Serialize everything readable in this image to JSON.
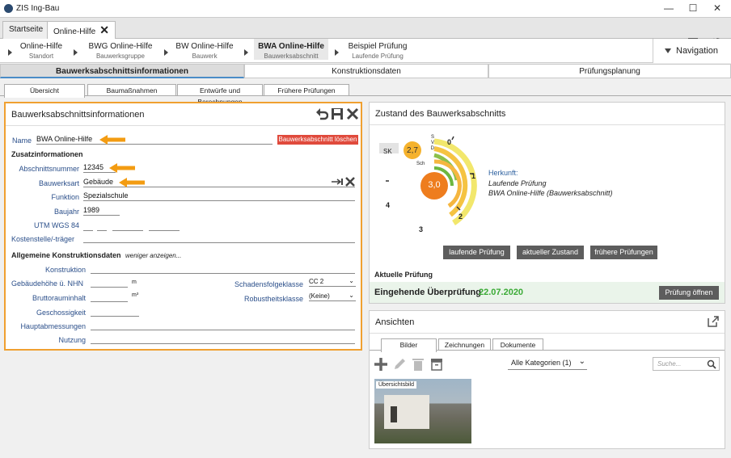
{
  "app": {
    "title": "ZIS Ing-Bau"
  },
  "tabs": [
    {
      "label": "Startseite"
    },
    {
      "label": "Online-Hilfe"
    }
  ],
  "breadcrumbs": [
    {
      "title": "Online-Hilfe",
      "sub": "Standort"
    },
    {
      "title": "BWG Online-Hilfe",
      "sub": "Bauwerksgruppe"
    },
    {
      "title": "BW Online-Hilfe",
      "sub": "Bauwerk"
    },
    {
      "title": "BWA Online-Hilfe",
      "sub": "Bauwerksabschnitt"
    },
    {
      "title": "Beispiel Prüfung",
      "sub": "Laufende Prüfung"
    }
  ],
  "navigation_label": "Navigation",
  "sections": [
    "Bauwerksabschnittsinformationen",
    "Konstruktionsdaten",
    "Prüfungsplanung"
  ],
  "subtabs": [
    "Übersicht",
    "Baumaßnahmen",
    "Entwürfe und Berechnungen",
    "Frühere Prüfungen"
  ],
  "info": {
    "header": "Bauwerksabschnittsinformationen",
    "name_label": "Name",
    "name_value": "BWA Online-Hilfe",
    "delete_button": "Bauwerksabschnitt löschen",
    "zusatz_heading": "Zusatzinformationen",
    "abschnitt_label": "Abschnittsnummer",
    "abschnitt_value": "12345",
    "bauwerksart_label": "Bauwerksart",
    "bauwerksart_value": "Gebäude",
    "funktion_label": "Funktion",
    "funktion_value": "Spezialschule",
    "baujahr_label": "Baujahr",
    "baujahr_value": "1989",
    "utm_label": "UTM WGS 84",
    "kosten_label": "Kostenstelle/-träger",
    "allg_heading": "Allgemeine Konstruktionsdaten",
    "weniger": "weniger anzeigen...",
    "konstruktion_label": "Konstruktion",
    "hoehe_label": "Gebäudehöhe ü. NHN",
    "hoehe_unit": "m",
    "brutto_label": "Bruttorauminhalt",
    "brutto_unit": "m³",
    "geschoss_label": "Geschossigkeit",
    "haupt_label": "Hauptabmessungen",
    "nutzung_label": "Nutzung",
    "schaden_label": "Schadensfolgeklasse",
    "schaden_value": "CC 2",
    "robust_label": "Robustheitsklasse",
    "robust_value": "(Keine)"
  },
  "zustand": {
    "header": "Zustand des Bauwerksabschnitts",
    "sk_label": "SK",
    "sk_value": "2,7",
    "center_value": "3,0",
    "ring_labels": [
      "S",
      "V",
      "D",
      "Sch"
    ],
    "scale": [
      "0",
      "1",
      "2",
      "3",
      "4"
    ],
    "herkunft_label": "Herkunft:",
    "herkunft_line1": "Laufende Prüfung",
    "herkunft_line2": "BWA Online-Hilfe (Bauwerksabschnitt)",
    "buttons": [
      "laufende Prüfung",
      "aktueller Zustand",
      "frühere Prüfungen"
    ],
    "aktuelle_label": "Aktuelle Prüfung",
    "pruefung_type": "Eingehende Überprüfung",
    "pruefung_date": "22.07.2020",
    "open_button": "Prüfung öffnen"
  },
  "ansichten": {
    "header": "Ansichten",
    "tabs": [
      "Bilder",
      "Zeichnungen",
      "Dokumente"
    ],
    "kategorie": "Alle Kategorien (1)",
    "search_placeholder": "Suche...",
    "image_caption": "Übersichtsbild"
  },
  "colors": {
    "accent": "#f39c12",
    "green": "#3aaa35",
    "red": "#e04a3c"
  }
}
